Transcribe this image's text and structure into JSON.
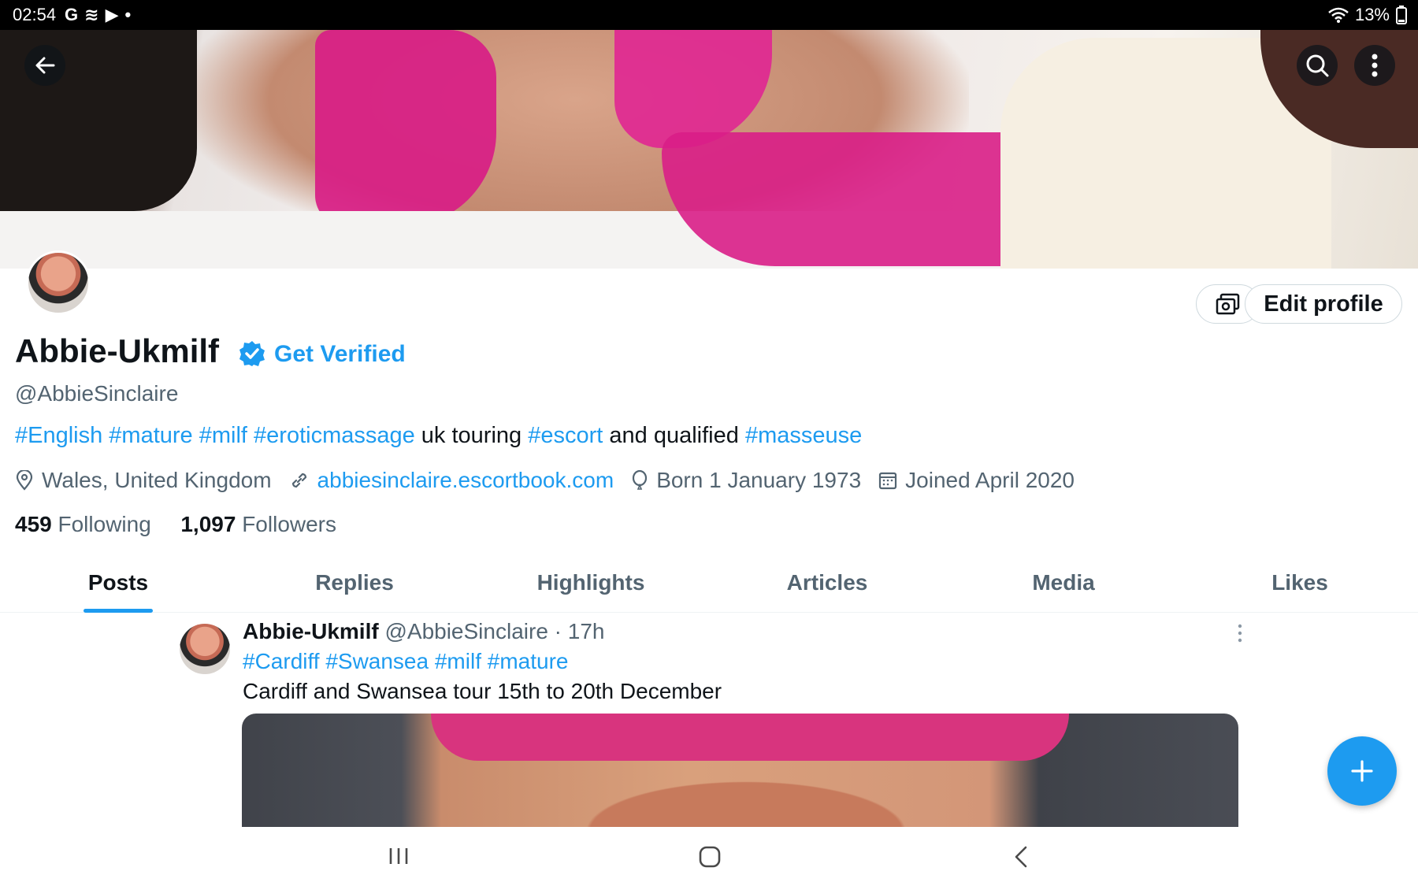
{
  "status_bar": {
    "time": "02:54",
    "battery": "13%",
    "notification_icons": [
      "G",
      "≋",
      "▶",
      "•"
    ]
  },
  "header": {
    "back_icon": "arrow-left-icon",
    "search_icon": "search-icon",
    "more_icon": "more-vertical-icon"
  },
  "profile": {
    "display_name": "Abbie-Ukmilf",
    "get_verified": "Get Verified",
    "handle": "@AbbieSinclaire",
    "edit_profile": "Edit profile",
    "bio": {
      "tags1": "#English #mature #milf  #eroticmassage",
      "text1": " uk touring ",
      "tag2": "#escort",
      "text2": " and qualified ",
      "tag3": "#masseuse"
    },
    "location": "Wales, United Kingdom",
    "website": "abbiesinclaire.escortbook.com",
    "born": "Born 1 January 1973",
    "joined": "Joined April 2020",
    "following_count": "459",
    "following_label": "Following",
    "followers_count": "1,097",
    "followers_label": "Followers"
  },
  "tabs": [
    {
      "label": "Posts",
      "active": true
    },
    {
      "label": "Replies"
    },
    {
      "label": "Highlights"
    },
    {
      "label": "Articles"
    },
    {
      "label": "Media"
    },
    {
      "label": "Likes"
    }
  ],
  "post": {
    "author": "Abbie-Ukmilf",
    "handle_time": "@AbbieSinclaire · 17h",
    "tags": "#Cardiff #Swansea #milf #mature",
    "text": "Cardiff and Swansea tour 15th to 20th December"
  },
  "colors": {
    "accent": "#1d9bf0",
    "text": "#0f1419",
    "muted": "#536471"
  }
}
